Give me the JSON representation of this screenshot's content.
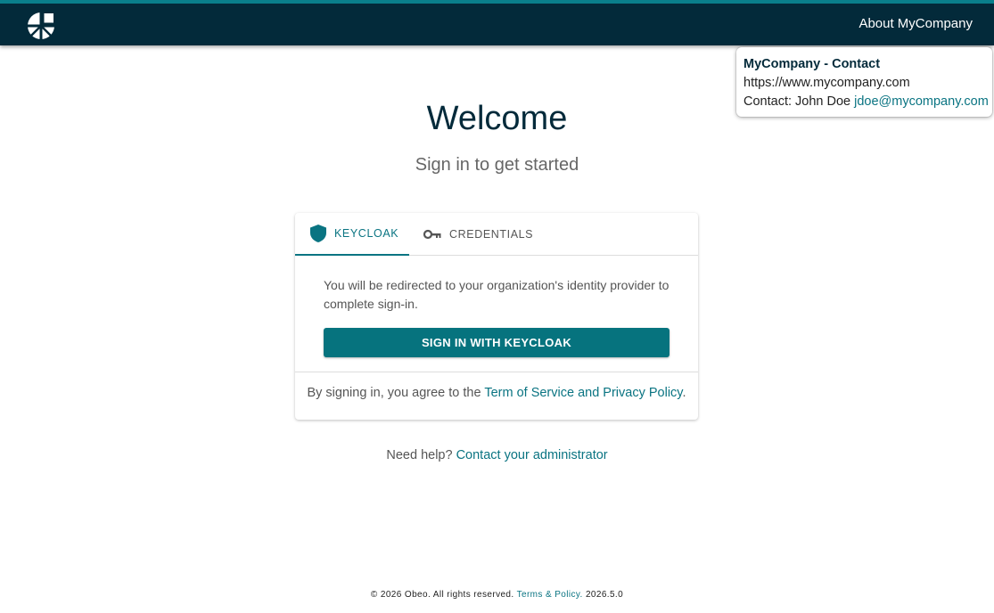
{
  "header": {
    "about_label": "About MyCompany",
    "logo_icon": "obeo-logo-icon",
    "background": "#032a3a",
    "accent": "#0a7f8c"
  },
  "popover": {
    "title": "MyCompany - Contact",
    "website": "https://www.mycompany.com",
    "contact_prefix": "Contact: John Doe ",
    "contact_email": "jdoe@mycompany.com"
  },
  "main": {
    "title": "Welcome",
    "subtitle": "Sign in to get started"
  },
  "card": {
    "tabs": [
      {
        "label": "KEYCLOAK",
        "icon": "shield-icon",
        "active": true
      },
      {
        "label": "CREDENTIALS",
        "icon": "key-icon",
        "active": false
      }
    ],
    "message": "You will be redirected to your organization's identity provider to complete sign-in.",
    "button_label": "SIGN IN WITH KEYCLOAK",
    "terms_prefix": "By signing in, you agree to the ",
    "terms_link": "Term of Service and Privacy Policy",
    "terms_suffix": "."
  },
  "help": {
    "prefix": "Need help? ",
    "link": "Contact your administrator"
  },
  "footer": {
    "copyright": "© 2026 Obeo. All rights reserved.",
    "terms_link": "Terms & Policy.",
    "version": "2026.5.0"
  },
  "colors": {
    "primary": "#06737e",
    "link": "#0a7482",
    "title": "#032a3a"
  }
}
